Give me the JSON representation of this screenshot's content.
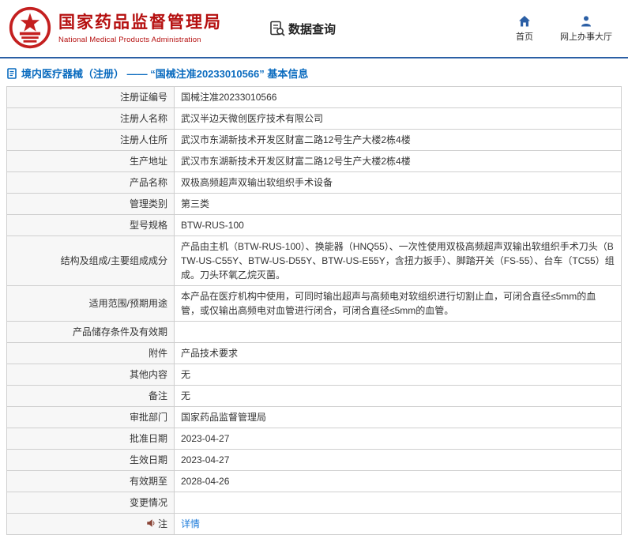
{
  "header": {
    "org_name": "国家药品监督管理局",
    "org_name_en": "National Medical Products Administration",
    "nav_query": "数据查询",
    "nav_home": "首页",
    "nav_hall": "网上办事大厅"
  },
  "page_title": {
    "text": "境内医疗器械（注册） —— “国械注准20233010566” 基本信息"
  },
  "accent_colors": {
    "brand_red": "#b50f0f",
    "brand_blue": "#2b5fa5",
    "title_blue": "#0a6bbf",
    "link_blue": "#1a7ad9"
  },
  "table": {
    "rows": [
      {
        "label": "注册证编号",
        "value": "国械注准20233010566"
      },
      {
        "label": "注册人名称",
        "value": "武汉半边天微创医疗技术有限公司"
      },
      {
        "label": "注册人住所",
        "value": "武汉市东湖新技术开发区财富二路12号生产大楼2栋4楼"
      },
      {
        "label": "生产地址",
        "value": "武汉市东湖新技术开发区财富二路12号生产大楼2栋4楼"
      },
      {
        "label": "产品名称",
        "value": "双极高频超声双输出软组织手术设备"
      },
      {
        "label": "管理类别",
        "value": "第三类"
      },
      {
        "label": "型号规格",
        "value": "BTW-RUS-100"
      },
      {
        "label": "结构及组成/主要组成成分",
        "value": "产品由主机（BTW-RUS-100）、换能器（HNQ55）、一次性使用双极高频超声双输出软组织手术刀头（BTW-US-C55Y、BTW-US-D55Y、BTW-US-E55Y，含扭力扳手）、脚踏开关（FS-55）、台车（TC55）组成。刀头环氧乙烷灭菌。"
      },
      {
        "label": "适用范围/预期用途",
        "value": "本产品在医疗机构中使用，可同时输出超声与高频电对软组织进行切割止血，可闭合直径≤5mm的血管，或仅输出高频电对血管进行闭合，可闭合直径≤5mm的血管。"
      },
      {
        "label": "产品储存条件及有效期",
        "value": ""
      },
      {
        "label": "附件",
        "value": "产品技术要求"
      },
      {
        "label": "其他内容",
        "value": "无"
      },
      {
        "label": "备注",
        "value": "无"
      },
      {
        "label": "审批部门",
        "value": "国家药品监督管理局"
      },
      {
        "label": "批准日期",
        "value": "2023-04-27"
      },
      {
        "label": "生效日期",
        "value": "2023-04-27"
      },
      {
        "label": "有效期至",
        "value": "2028-04-26"
      },
      {
        "label": "变更情况",
        "value": ""
      },
      {
        "label": "注",
        "value": "详情",
        "link": true,
        "icon": "notice-icon"
      }
    ]
  }
}
